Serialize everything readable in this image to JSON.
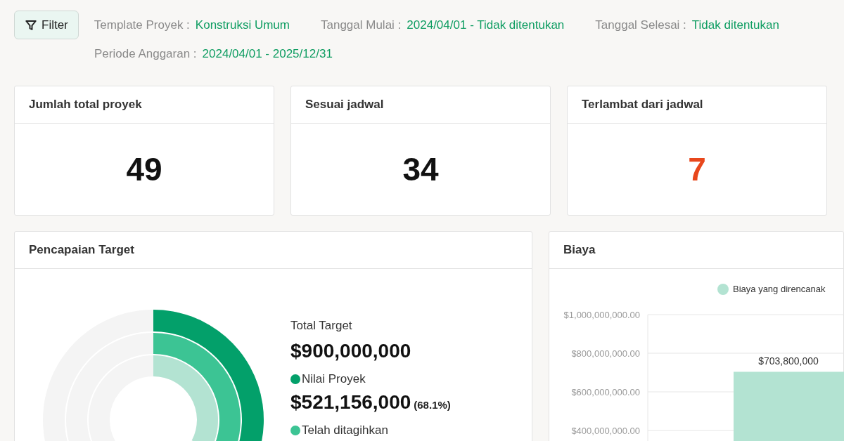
{
  "filter": {
    "button": "Filter",
    "fields": [
      {
        "label": "Template Proyek :",
        "value": "Konstruksi Umum"
      },
      {
        "label": "Tanggal Mulai :",
        "value": "2024/04/01 - Tidak ditentukan"
      },
      {
        "label": "Tanggal Selesai :",
        "value": "Tidak ditentukan"
      },
      {
        "label": "Periode Anggaran :",
        "value": "2024/04/01 - 2025/12/31"
      }
    ]
  },
  "stats": [
    {
      "title": "Jumlah total proyek",
      "value": "49",
      "kind": "normal"
    },
    {
      "title": "Sesuai jadwal",
      "value": "34",
      "kind": "normal"
    },
    {
      "title": "Terlambat dari jadwal",
      "value": "7",
      "kind": "alert"
    }
  ],
  "target": {
    "title": "Pencapaian Target",
    "total_label": "Total Target",
    "total_value": "$900,000,000",
    "items": [
      {
        "label": "Nilai Proyek",
        "value": "$521,156,000",
        "percent": "(68.1%)",
        "color": "#03a06a"
      },
      {
        "label": "Telah ditagihkan",
        "color": "#3cc494"
      }
    ]
  },
  "cost": {
    "title": "Biaya",
    "chart_data": {
      "type": "bar",
      "grid": true,
      "series": [
        {
          "name": "Biaya yang direncanak",
          "color": "#b3e3d2",
          "values": [
            703800000
          ]
        }
      ],
      "ylim": [
        0,
        1000000000
      ],
      "yticks": [
        {
          "value": 1000000000,
          "label": "$1,000,000,000.00"
        },
        {
          "value": 800000000,
          "label": "$800,000,000.00"
        },
        {
          "value": 600000000,
          "label": "$600,000,000.00"
        },
        {
          "value": 400000000,
          "label": "$400,000,000.00"
        }
      ],
      "value_labels": [
        "$703,800,000"
      ]
    }
  }
}
